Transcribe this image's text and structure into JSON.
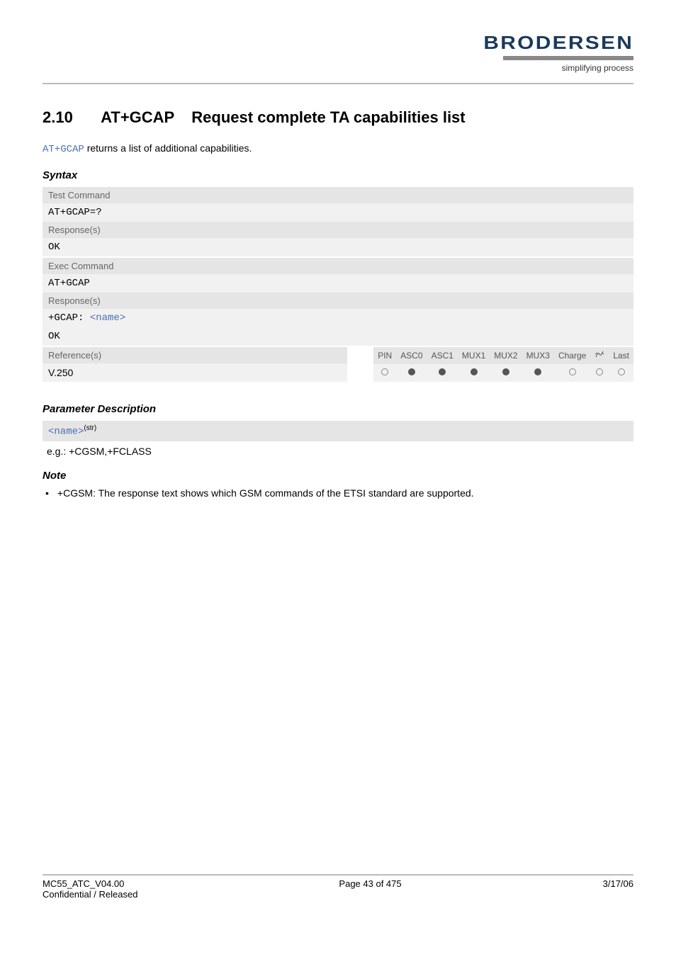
{
  "brand": {
    "logo": "BRODERSEN",
    "tagline": "simplifying process"
  },
  "section": {
    "number": "2.10",
    "command": "AT+GCAP",
    "title": "Request complete TA capabilities list"
  },
  "intro": {
    "code": "AT+GCAP",
    "text": " returns a list of additional capabilities."
  },
  "headings": {
    "syntax": "Syntax",
    "param_desc": "Parameter Description",
    "note": "Note"
  },
  "syntax": {
    "test_label": "Test Command",
    "test_cmd": "AT+GCAP=?",
    "resp_label": "Response(s)",
    "test_resp": "OK",
    "exec_label": "Exec Command",
    "exec_cmd": "AT+GCAP",
    "exec_resp_prefix": "+GCAP: ",
    "exec_resp_param": "<name>",
    "exec_resp_ok": "OK",
    "ref_label": "Reference(s)",
    "ref_value": "V.250"
  },
  "applic": {
    "cols": [
      "PIN",
      "ASC0",
      "ASC1",
      "MUX1",
      "MUX2",
      "MUX3",
      "Charge",
      "",
      "Last"
    ],
    "vals": [
      "o",
      "f",
      "f",
      "f",
      "f",
      "f",
      "o",
      "o",
      "o"
    ]
  },
  "param": {
    "name": "<name>",
    "type": "(str)",
    "example": "e.g.: +CGSM,+FCLASS"
  },
  "note_item": "+CGSM: The response text shows which GSM commands of the ETSI standard are supported.",
  "footer": {
    "doc": "MC55_ATC_V04.00",
    "status": "Confidential / Released",
    "page": "Page 43 of 475",
    "date": "3/17/06"
  }
}
